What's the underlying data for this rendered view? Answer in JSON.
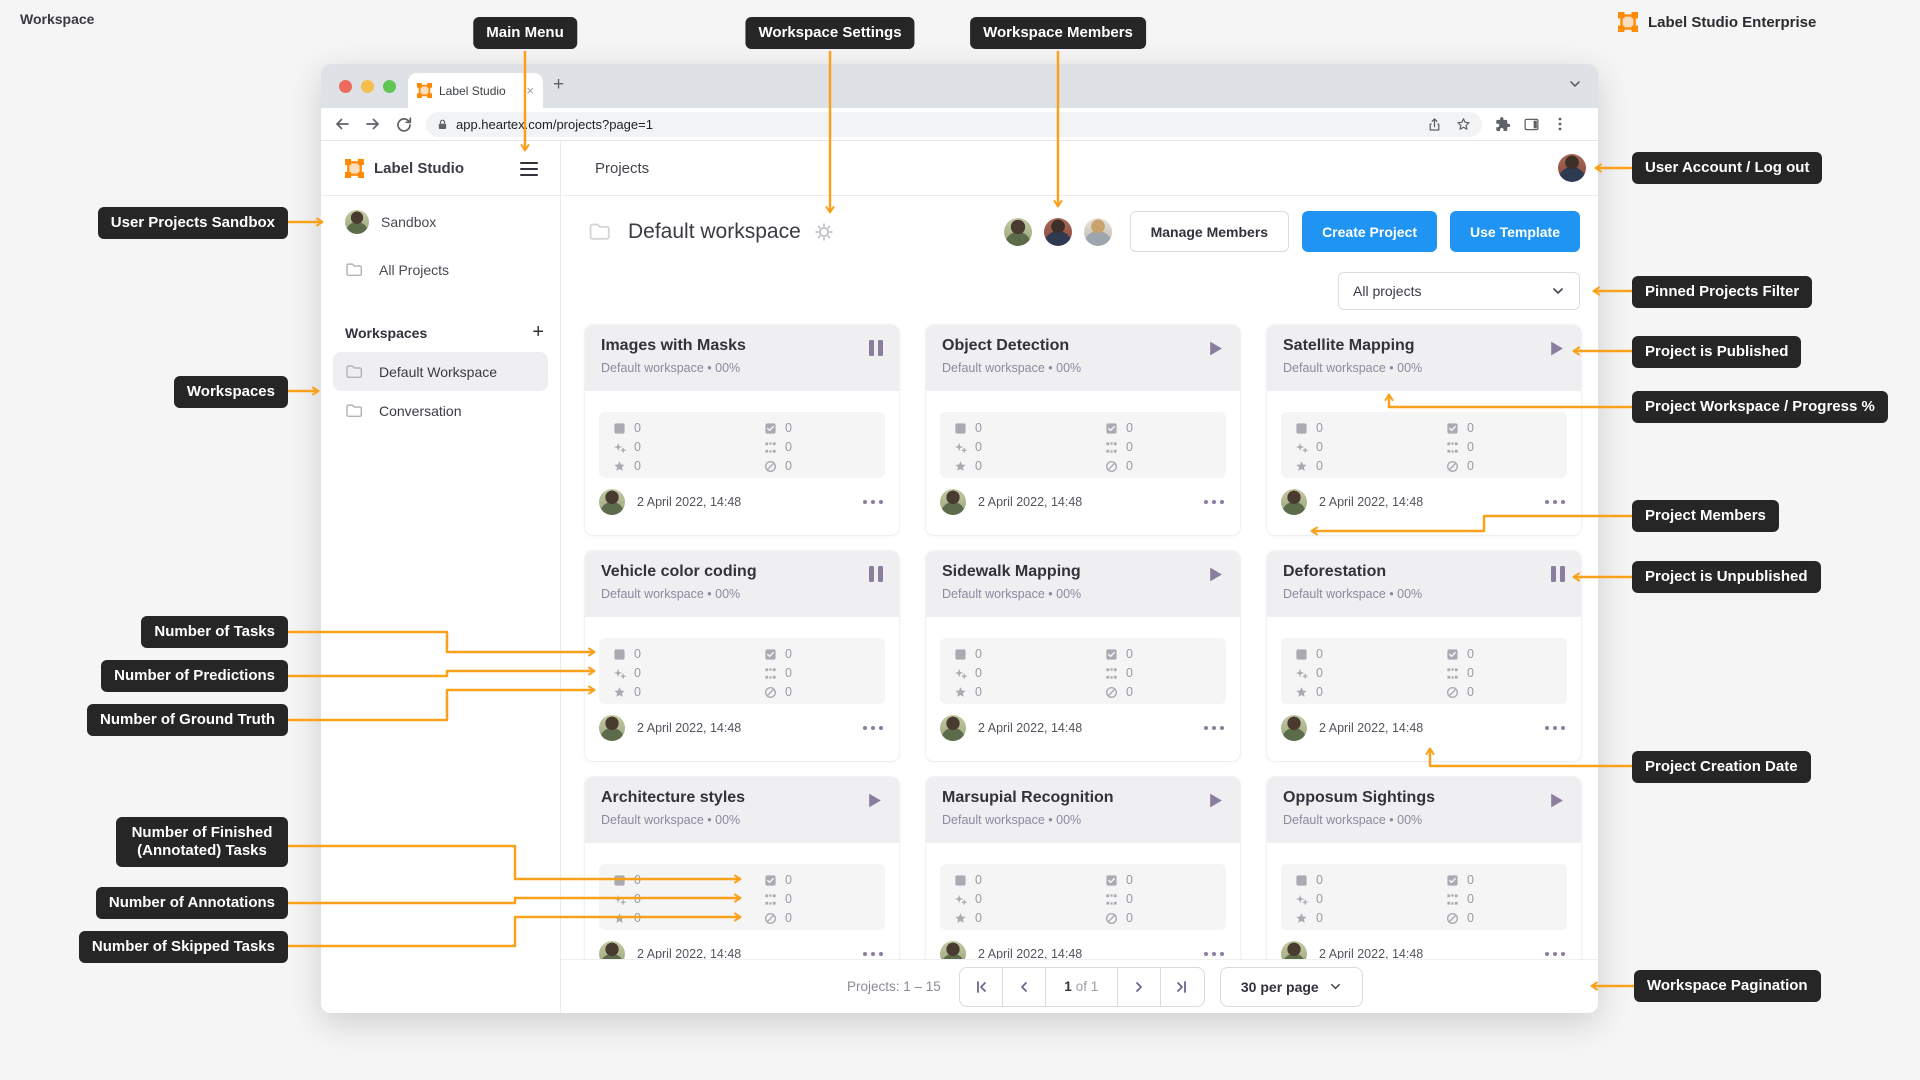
{
  "page": {
    "title": "Workspace"
  },
  "brand": {
    "enterprise": "Label Studio Enterprise"
  },
  "callouts": {
    "main_menu": "Main Menu",
    "workspace_settings": "Workspace Settings",
    "workspace_members": "Workspace Members",
    "user_account": "User Account / Log out",
    "user_projects_sandbox": "User Projects Sandbox",
    "pinned_projects_filter": "Pinned Projects Filter",
    "project_is_published": "Project is Published",
    "project_workspace_progress": "Project Workspace / Progress %",
    "workspaces": "Workspaces",
    "project_members": "Project Members",
    "project_is_unpublished": "Project is Unpublished",
    "number_of_tasks": "Number of Tasks",
    "number_of_predictions": "Number of Predictions",
    "number_of_ground_truth": "Number of Ground Truth",
    "project_creation_date": "Project Creation Date",
    "number_of_finished": "Number of Finished (Annotated) Tasks",
    "number_of_annotations": "Number of Annotations",
    "number_of_skipped": "Number of Skipped Tasks",
    "workspace_pagination": "Workspace Pagination"
  },
  "browser": {
    "tab_title": "Label Studio",
    "tab_close": "×",
    "new_tab": "+",
    "url": "app.heartex.com/projects?page=1"
  },
  "app": {
    "brand": "Label Studio",
    "header_title": "Projects",
    "sidebar": {
      "sandbox": "Sandbox",
      "all_projects": "All Projects",
      "workspaces_header": "Workspaces",
      "add_workspace": "+",
      "workspaces": [
        {
          "label": "Default Workspace"
        },
        {
          "label": "Conversation"
        }
      ]
    },
    "workspace": {
      "title": "Default workspace",
      "manage_members": "Manage Members",
      "create_project": "Create Project",
      "use_template": "Use Template",
      "filter_selected": "All projects"
    },
    "projects": [
      {
        "title": "Images with Masks",
        "subtitle": "Default workspace • 00%",
        "state": "paused",
        "date": "2 April 2022, 14:48",
        "stats": {
          "tasks": 0,
          "predictions": 0,
          "ground_truth": 0,
          "finished": 0,
          "annotations": 0,
          "skipped": 0
        }
      },
      {
        "title": "Object Detection",
        "subtitle": "Default workspace • 00%",
        "state": "published",
        "date": "2 April 2022, 14:48",
        "stats": {
          "tasks": 0,
          "predictions": 0,
          "ground_truth": 0,
          "finished": 0,
          "annotations": 0,
          "skipped": 0
        }
      },
      {
        "title": "Satellite Mapping",
        "subtitle": "Default workspace • 00%",
        "state": "published",
        "date": "2 April 2022, 14:48",
        "stats": {
          "tasks": 0,
          "predictions": 0,
          "ground_truth": 0,
          "finished": 0,
          "annotations": 0,
          "skipped": 0
        }
      },
      {
        "title": "Vehicle color coding",
        "subtitle": "Default workspace • 00%",
        "state": "paused",
        "date": "2 April 2022, 14:48",
        "stats": {
          "tasks": 0,
          "predictions": 0,
          "ground_truth": 0,
          "finished": 0,
          "annotations": 0,
          "skipped": 0
        }
      },
      {
        "title": "Sidewalk Mapping",
        "subtitle": "Default workspace • 00%",
        "state": "published",
        "date": "2 April 2022, 14:48",
        "stats": {
          "tasks": 0,
          "predictions": 0,
          "ground_truth": 0,
          "finished": 0,
          "annotations": 0,
          "skipped": 0
        }
      },
      {
        "title": "Deforestation",
        "subtitle": "Default workspace • 00%",
        "state": "paused",
        "date": "2 April 2022, 14:48",
        "stats": {
          "tasks": 0,
          "predictions": 0,
          "ground_truth": 0,
          "finished": 0,
          "annotations": 0,
          "skipped": 0
        }
      },
      {
        "title": "Architecture styles",
        "subtitle": "Default workspace • 00%",
        "state": "published",
        "date": "2 April 2022, 14:48",
        "stats": {
          "tasks": 0,
          "predictions": 0,
          "ground_truth": 0,
          "finished": 0,
          "annotations": 0,
          "skipped": 0
        }
      },
      {
        "title": "Marsupial Recognition",
        "subtitle": "Default workspace • 00%",
        "state": "published",
        "date": "2 April 2022, 14:48",
        "stats": {
          "tasks": 0,
          "predictions": 0,
          "ground_truth": 0,
          "finished": 0,
          "annotations": 0,
          "skipped": 0
        }
      },
      {
        "title": "Opposum Sightings",
        "subtitle": "Default workspace • 00%",
        "state": "published",
        "date": "2 April 2022, 14:48",
        "stats": {
          "tasks": 0,
          "predictions": 0,
          "ground_truth": 0,
          "finished": 0,
          "annotations": 0,
          "skipped": 0
        }
      }
    ],
    "pagination": {
      "summary": "Projects: 1 – 15",
      "page": "1",
      "of": "of 1",
      "per_page": "30 per page"
    }
  },
  "colors": {
    "accent_orange": "#F9A11B",
    "brand_orange": "#FF8A05",
    "primary_blue": "#2094F3",
    "callout_bg": "#262626"
  }
}
